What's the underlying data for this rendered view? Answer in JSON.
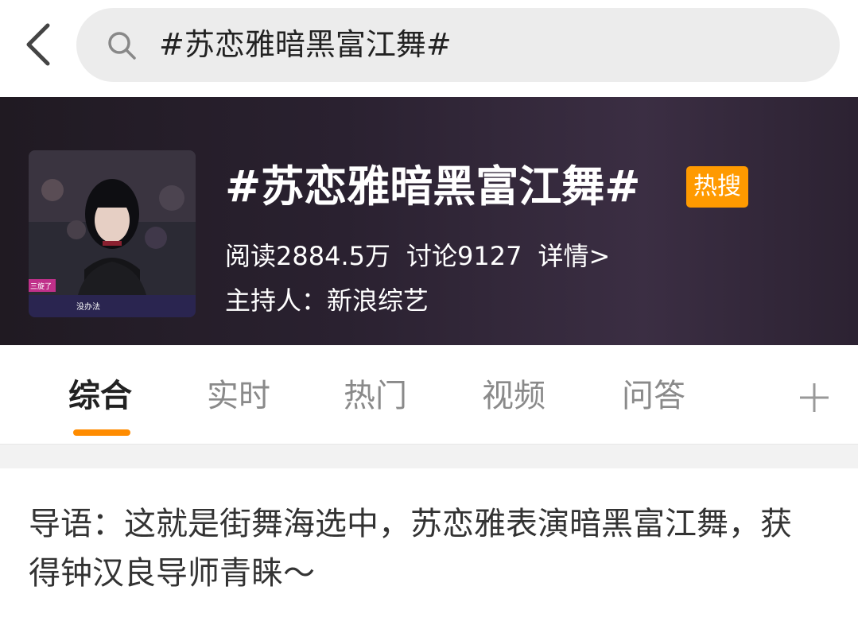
{
  "search": {
    "query": "#苏恋雅暗黑富江舞#"
  },
  "topic": {
    "title": "#苏恋雅暗黑富江舞#",
    "hot_badge": "热搜",
    "reads": "阅读2884.5万",
    "discussions": "讨论9127",
    "details_link": "详情>",
    "host": "主持人：新浪综艺",
    "thumbnail_caption": "没办法",
    "thumbnail_logo": "三旋了"
  },
  "tabs": [
    {
      "label": "综合",
      "active": true
    },
    {
      "label": "实时",
      "active": false
    },
    {
      "label": "热门",
      "active": false
    },
    {
      "label": "视频",
      "active": false
    },
    {
      "label": "问答",
      "active": false
    }
  ],
  "intro": {
    "text": "导语：这就是街舞海选中，苏恋雅表演暗黑富江舞，获得钟汉良导师青睐～"
  },
  "colors": {
    "accent": "#ff8c00",
    "badge": "#ff9a00",
    "hero_bg": "#2a2130"
  },
  "icons": {
    "back": "chevron-left-icon",
    "search": "search-icon",
    "more_tabs": "plus-icon"
  }
}
